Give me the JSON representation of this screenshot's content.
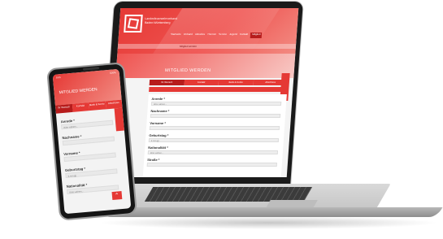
{
  "colors": {
    "accent": "#e53935",
    "accent_dark": "#b71c1c"
  },
  "laptop": {
    "logo_text": "Landesfeuerwehrverband Baden-Württemberg",
    "nav": [
      "Startseite",
      "Verband",
      "Aktuelles",
      "Themen",
      "Service",
      "Jugend",
      "Kontakt",
      "Mitglied"
    ],
    "strip_text": "Mitglied werden",
    "page_title": "MITGLIED WERDEN",
    "tabs": [
      "Ihr Wunsch",
      "Kontakt",
      "Bank & Konto",
      "Abschluss"
    ],
    "fields": [
      {
        "label": "Anrede *",
        "value": "Bitte wählen..."
      },
      {
        "label": "Nachname *",
        "value": ""
      },
      {
        "label": "Vorname *",
        "value": ""
      },
      {
        "label": "Geburtstag *",
        "value": "tt.mm.jjjj"
      },
      {
        "label": "Nationalität *",
        "value": "Bitte wählen..."
      },
      {
        "label": "Straße *",
        "value": ""
      }
    ]
  },
  "phone": {
    "status_time": "9:41",
    "status_right": "100%",
    "page_title": "MITGLIED WERDEN",
    "tabs": [
      "Ihr Wunsch",
      "Kontakt",
      "Bank & Konto",
      "Abschluss"
    ],
    "fields": [
      {
        "label": "Anrede *",
        "value": "Bitte wählen..."
      },
      {
        "label": "Nachname *",
        "value": ""
      },
      {
        "label": "Vorname *",
        "value": ""
      },
      {
        "label": "Geburtstag *",
        "value": "tt.mm.jjjj"
      },
      {
        "label": "Nationalität *",
        "value": "Bitte wählen..."
      }
    ],
    "fab_icon": "chevron-up-icon",
    "fab_glyph": "⌃"
  }
}
